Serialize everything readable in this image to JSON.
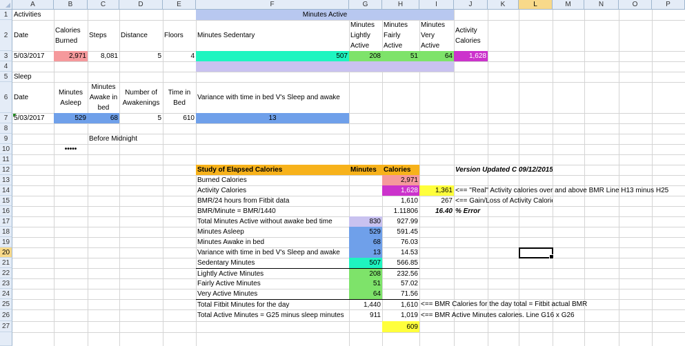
{
  "colors": {
    "salmon": "#f5999c",
    "aqua": "#1ef5c0",
    "green": "#7ee36a",
    "magenta": "#cc33cc",
    "lavender": "#c9c2f0",
    "blue": "#6fa0ea",
    "lightblue": "#b8c8f0",
    "orange": "#f7b21b",
    "yellow": "#ffff3c",
    "header_bg": "#e4ecf7"
  },
  "columns": [
    "A",
    "B",
    "C",
    "D",
    "E",
    "F",
    "G",
    "H",
    "I",
    "J",
    "K",
    "L",
    "M",
    "N",
    "O",
    "P"
  ],
  "rows": [
    "1",
    "2",
    "3",
    "4",
    "5",
    "6",
    "7",
    "8",
    "9",
    "10",
    "11",
    "12",
    "13",
    "14",
    "15",
    "16",
    "17",
    "18",
    "19",
    "20",
    "21",
    "22",
    "23",
    "24",
    "25",
    "26",
    "27"
  ],
  "cells": {
    "A1": "Activities",
    "F1": "Minutes  Active",
    "A2": "Date",
    "B2": "Calories Burned",
    "C2": "Steps",
    "D2": "Distance",
    "E2": "Floors",
    "F2": "Minutes Sedentary",
    "G2": "Minutes Lightly Active",
    "H2": "Minutes Fairly Active",
    "I2": "Minutes Very Active",
    "J2": "Activity Calories",
    "A3": "5/03/2017",
    "B3": "2,971",
    "C3": "8,081",
    "D3": "5",
    "E3": "4",
    "F3": "507",
    "G3": "208",
    "H3": "51",
    "I3": "64",
    "J3": "1,628",
    "A5": "Sleep",
    "A6": "Date",
    "B6": "Minutes Asleep",
    "C6": "Minutes Awake in bed",
    "D6": "Number of Awakenings",
    "E6": "Time in Bed",
    "F6": "Variance with time in bed V's Sleep and awake",
    "A7": "5/03/2017",
    "B7": "529",
    "C7": "68",
    "D7": "5",
    "E7": "610",
    "F7": "13",
    "C9": "Before Midnight",
    "B10": "•••••",
    "F12": "Study of Elapsed Calories",
    "G12": "Minutes",
    "H12": "Calories",
    "J12": "Version Updated C 09/12/2015",
    "F13": "Burned Calories",
    "H13": "2,971",
    "F14": "Activity Calories",
    "H14": "1,628",
    "I14": "1,361",
    "J14": "<== \"Real\" Activity calories over and above BMR Line H13 minus H25",
    "F15": "BMR/24 hours from Fitbit data",
    "H15": "1,610",
    "I15": "267",
    "J15": "<== Gain/Loss of Activity Calories",
    "F16": "BMR/Minute = BMR/1440",
    "H16": "1.11806",
    "I16": "16.40",
    "J16": "% Error",
    "F17": "Total Minutes Active without awake bed time",
    "G17": "830",
    "H17": "927.99",
    "F18": "Minutes Asleep",
    "G18": "529",
    "H18": "591.45",
    "F19": "Minutes Awake in bed",
    "G19": "68",
    "H19": "76.03",
    "F20": "Variance with time in bed V's Sleep and awake",
    "G20": "13",
    "H20": "14.53",
    "F21": "Sedentary Minutes",
    "G21": "507",
    "H21": "566.85",
    "F22": "Lightly Active Minutes",
    "G22": "208",
    "H22": "232.56",
    "F23": "Fairly Active Minutes",
    "G23": "51",
    "H23": "57.02",
    "F24": "Very Active Minutes",
    "G24": "64",
    "H24": "71.56",
    "F25": "Total Fitbit Minutes for the day",
    "G25": "1,440",
    "H25": "1,610",
    "I25": "<== BMR Calories for the day total = Fitbit actual BMR",
    "F26": "Total Active Minutes = G25 minus sleep minutes",
    "G26": "911",
    "H26": "1,019",
    "I26": "<== BMR Active Minutes calories. Line G16 x G26",
    "H27": "609"
  }
}
